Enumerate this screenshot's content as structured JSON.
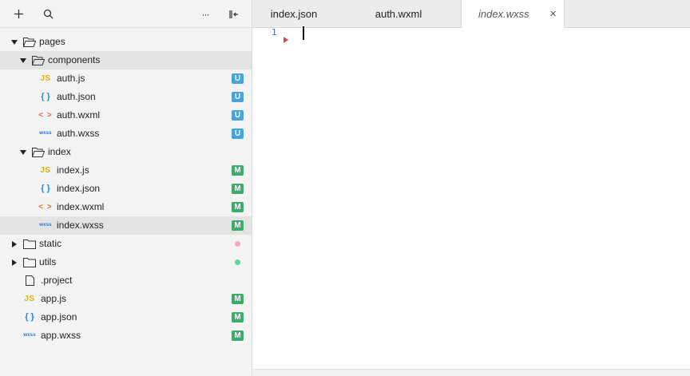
{
  "sidebar": {
    "toolbar": {
      "add_icon": "plus-icon",
      "search_icon": "search-icon",
      "more_label": "···",
      "collapse_icon": "collapse-all-icon"
    },
    "tree": [
      {
        "name": "pages",
        "type": "folder",
        "expanded": true,
        "depth": 0
      },
      {
        "name": "components",
        "type": "folder",
        "expanded": true,
        "depth": 1,
        "highlight": true
      },
      {
        "name": "auth.js",
        "type": "js",
        "depth": 2,
        "badge": "U"
      },
      {
        "name": "auth.json",
        "type": "json",
        "depth": 2,
        "badge": "U"
      },
      {
        "name": "auth.wxml",
        "type": "wxml",
        "depth": 2,
        "badge": "U"
      },
      {
        "name": "auth.wxss",
        "type": "wxss",
        "depth": 2,
        "badge": "U"
      },
      {
        "name": "index",
        "type": "folder",
        "expanded": true,
        "depth": 1
      },
      {
        "name": "index.js",
        "type": "js",
        "depth": 2,
        "badge": "M"
      },
      {
        "name": "index.json",
        "type": "json",
        "depth": 2,
        "badge": "M"
      },
      {
        "name": "index.wxml",
        "type": "wxml",
        "depth": 2,
        "badge": "M"
      },
      {
        "name": "index.wxss",
        "type": "wxss",
        "depth": 2,
        "badge": "M",
        "selected": true
      },
      {
        "name": "static",
        "type": "folder",
        "expanded": false,
        "depth": 0,
        "dot": "#f4a6c0"
      },
      {
        "name": "utils",
        "type": "folder",
        "expanded": false,
        "depth": 0,
        "dot": "#5fd3a0"
      },
      {
        "name": ".project",
        "type": "file",
        "depth": 0
      },
      {
        "name": "app.js",
        "type": "js",
        "depth": 0,
        "badge": "M"
      },
      {
        "name": "app.json",
        "type": "json",
        "depth": 0,
        "badge": "M"
      },
      {
        "name": "app.wxss",
        "type": "wxss",
        "depth": 0,
        "badge": "M"
      }
    ],
    "icon_text": {
      "js": "JS",
      "json": "{ }",
      "wxml": "< >",
      "wxss": "wxss"
    },
    "badge_colors": {
      "U": "#4aa3d8",
      "M": "#3cab6b"
    }
  },
  "editor": {
    "tabs": [
      {
        "label": "index.json",
        "active": false
      },
      {
        "label": "auth.wxml",
        "active": false
      },
      {
        "label": "index.wxss",
        "active": true,
        "close": "×"
      }
    ],
    "line_number": "1"
  }
}
